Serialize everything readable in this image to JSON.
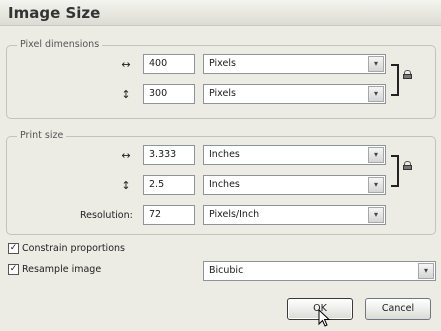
{
  "window": {
    "title": "Image Size"
  },
  "pixel_dimensions": {
    "legend": "Pixel dimensions",
    "width": {
      "icon": "horizontal-arrows-icon",
      "value": "400",
      "unit": "Pixels"
    },
    "height": {
      "icon": "vertical-arrow-icon",
      "value": "300",
      "unit": "Pixels"
    }
  },
  "print_size": {
    "legend": "Print size",
    "width": {
      "icon": "horizontal-arrows-icon",
      "value": "3.333",
      "unit": "Inches"
    },
    "height": {
      "icon": "vertical-arrow-icon",
      "value": "2.5",
      "unit": "Inches"
    },
    "resolution": {
      "label": "Resolution:",
      "value": "72",
      "unit": "Pixels/Inch"
    }
  },
  "glyphs": {
    "horiz": "↔",
    "vert": "↕",
    "dropdown": "▾",
    "checkmark": "✓"
  },
  "options": {
    "constrain": {
      "label": "Constrain proportions",
      "checked": true
    },
    "resample": {
      "label": "Resample image",
      "checked": true,
      "method": "Bicubic"
    }
  },
  "buttons": {
    "ok": "OK",
    "cancel": "Cancel"
  }
}
